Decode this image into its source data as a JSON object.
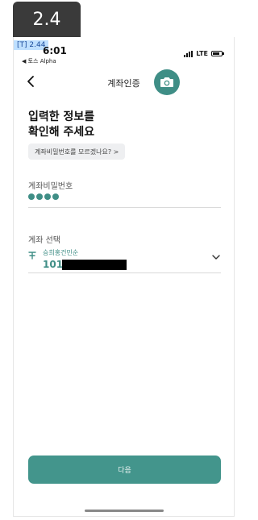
{
  "overlay": {
    "step_label": "2.4",
    "debug_tag": "[T] 2.44"
  },
  "status_bar": {
    "time": "6:01",
    "back_app": "◀ 토스 Alpha",
    "network": "LTE"
  },
  "header": {
    "title": "계좌인증",
    "back_icon": "chevron-left-icon",
    "camera_icon": "camera-icon"
  },
  "form": {
    "headline_line1": "입력한 정보를",
    "headline_line2": "확인해 주세요",
    "help_chip": "계좌비밀번호를 모르겠나요? >",
    "password_label": "계좌비밀번호",
    "password_digits_entered": 4,
    "account_label": "계좌 선택",
    "account_holder": "승희홍건민순",
    "account_number_visible": "101-"
  },
  "footer": {
    "next_label": "다음"
  },
  "colors": {
    "accent": "#43958c",
    "accent_dark": "#3f8e86",
    "badge_bg": "#3a3a3a",
    "chip_bg": "#eeeff1"
  }
}
